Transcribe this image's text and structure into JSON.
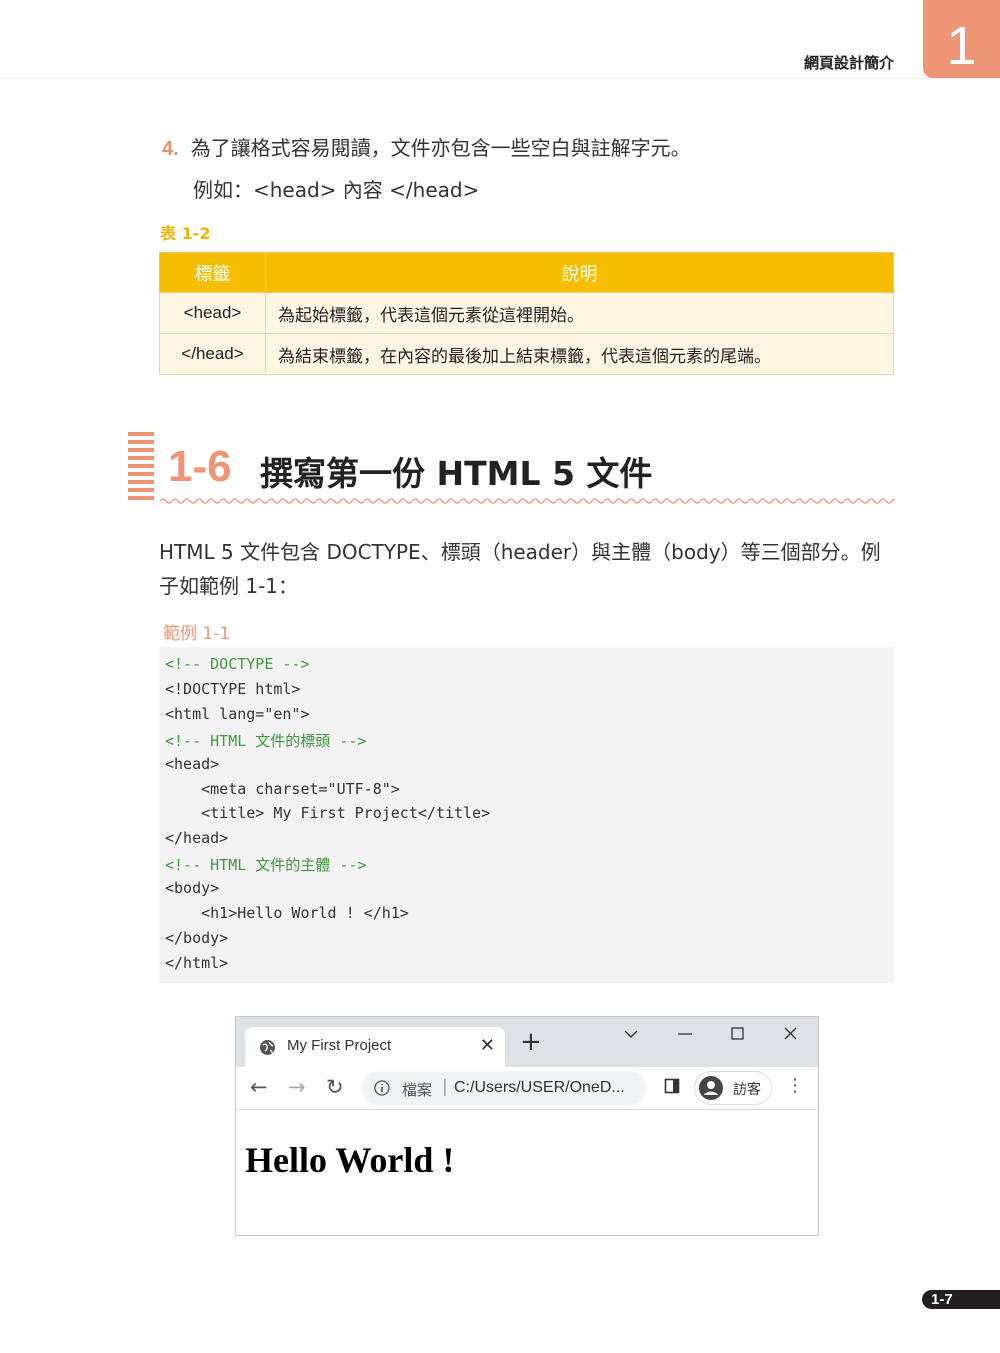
{
  "header": {
    "chapter_title": "網頁設計簡介",
    "chapter_number": "1"
  },
  "item4": {
    "number": "4.",
    "text": "為了讓格式容易閱讀，文件亦包含一些空白與註解字元。",
    "example": "例如：<head> 內容 </head>"
  },
  "table": {
    "caption": "表 1-2",
    "headers": [
      "標籤",
      "說明"
    ],
    "rows": [
      [
        "<head>",
        "為起始標籤，代表這個元素從這裡開始。"
      ],
      [
        "</head>",
        "為結束標籤，在內容的最後加上結束標籤，代表這個元素的尾端。"
      ]
    ]
  },
  "section": {
    "number": "1-6",
    "title": "撰寫第一份 HTML 5 文件"
  },
  "paragraph": "HTML 5 文件包含 DOCTYPE、標頭（header）與主體（body）等三個部分。例子如範例 1-1：",
  "example_caption": "範例 1-1",
  "code_lines": [
    {
      "text": "<!-- DOCTYPE -->",
      "comment": true
    },
    {
      "text": "<!DOCTYPE html>",
      "comment": false
    },
    {
      "text": "<html lang=\"en\">",
      "comment": false
    },
    {
      "text": "<!-- HTML 文件的標頭 -->",
      "comment": true
    },
    {
      "text": "<head>",
      "comment": false
    },
    {
      "text": "    <meta charset=\"UTF-8\">",
      "comment": false
    },
    {
      "text": "    <title> My First Project</title>",
      "comment": false
    },
    {
      "text": "</head>",
      "comment": false
    },
    {
      "text": "<!-- HTML 文件的主體 -->",
      "comment": true
    },
    {
      "text": "<body>",
      "comment": false
    },
    {
      "text": "    <h1>Hello World ! </h1>",
      "comment": false
    },
    {
      "text": "</body>",
      "comment": false
    },
    {
      "text": "</html>",
      "comment": false
    }
  ],
  "browser": {
    "tab_title": "My First Project",
    "address_label": "檔案",
    "address_url": "C:/Users/USER/OneD...",
    "profile_label": "訪客",
    "page_heading": "Hello World !"
  },
  "page_number": "1-7",
  "colors": {
    "accent": "#ee9477",
    "table_header": "#f6be00",
    "code_comment": "#3d9a3d"
  }
}
